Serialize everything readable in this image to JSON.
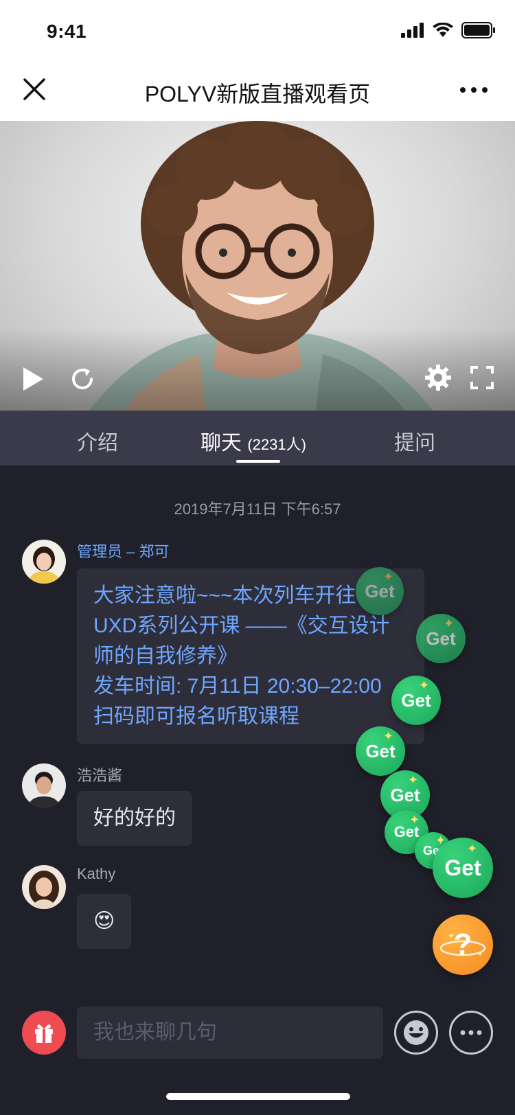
{
  "status_bar": {
    "time": "9:41"
  },
  "navbar": {
    "title": "POLYV新版直播观看页"
  },
  "tabs": {
    "intro": "介绍",
    "chat": "聊天",
    "chat_count": "(2231人)",
    "question": "提问"
  },
  "chat": {
    "timestamp": "2019年7月11日 下午6:57",
    "messages": [
      {
        "sender": "管理员 – 郑可",
        "lines": [
          "大家注意啦~~~本次列车开往",
          "UXD系列公开课 ——《交互设计",
          "师的自我修养》",
          "发车时间: 7月11日 20:30–22:00",
          "扫码即可报名听取课程"
        ]
      },
      {
        "sender": "浩浩酱",
        "lines": [
          "好的好的"
        ]
      },
      {
        "sender": "Kathy",
        "lines": [
          "😍"
        ]
      }
    ]
  },
  "reactions": {
    "get_label": "Get",
    "help_label": "?"
  },
  "input": {
    "placeholder": "我也来聊几句"
  },
  "colors": {
    "accent_blue": "#6fa6ff",
    "get_green": "#1ca85b",
    "gift_red": "#ef4b52",
    "help_orange": "#f58a1f",
    "chat_bg": "#1f2029",
    "tab_bg": "#3a3a4a"
  },
  "icons": {
    "status": [
      "signal-icon",
      "wifi-icon",
      "battery-icon"
    ],
    "navbar": [
      "close-icon",
      "more-dots-icon"
    ],
    "video": [
      "play-icon",
      "refresh-icon",
      "settings-icon",
      "fullscreen-icon"
    ],
    "input": [
      "gift-icon",
      "emoji-icon",
      "more-dots-icon"
    ]
  }
}
